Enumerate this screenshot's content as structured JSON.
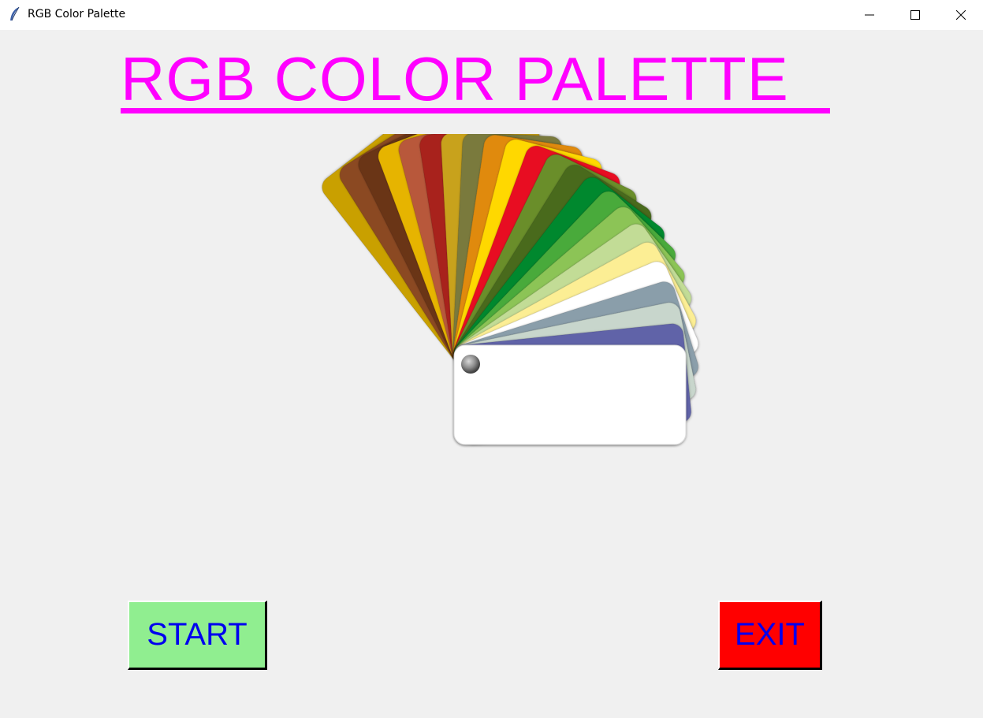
{
  "window": {
    "title": "RGB Color Palette",
    "controls": {
      "minimize": "minimize-icon",
      "maximize": "maximize-icon",
      "close": "close-icon"
    }
  },
  "heading": {
    "text": "RGB COLOR PALETTE",
    "color": "#ff00ff"
  },
  "swatch_fan": {
    "colors": [
      "#c9a000",
      "#8b4a22",
      "#6b3418",
      "#e6b400",
      "#b8583a",
      "#a8241a",
      "#c8a21a",
      "#7a7a3e",
      "#e08a10",
      "#ffd800",
      "#e81020",
      "#6a8e2a",
      "#4a6a1e",
      "#00882e",
      "#4aaa3a",
      "#8cc456",
      "#c2dc96",
      "#fcee94",
      "#ffffff",
      "#8a9eaa",
      "#c8d6cc",
      "#6064a8",
      "#3e5e62",
      "#ffffff"
    ]
  },
  "buttons": {
    "start": {
      "label": "START",
      "background": "#90ee90",
      "text_color": "#0000ee"
    },
    "exit": {
      "label": "EXIT",
      "background": "#ff0000",
      "text_color": "#0000ee"
    }
  }
}
